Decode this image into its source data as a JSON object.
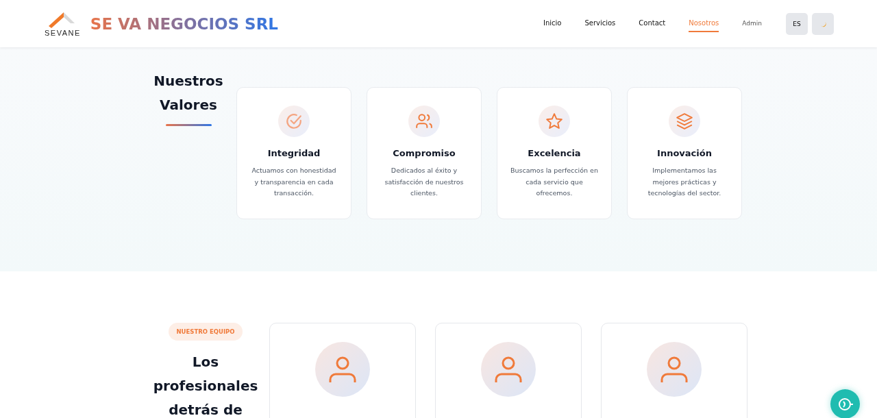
{
  "header": {
    "logo_text": "SEVANE",
    "brand": "SE VA NEGOCIOS SRL",
    "nav": [
      {
        "label": "Inicio",
        "kind": "link",
        "selected": false
      },
      {
        "label": "Servicios",
        "kind": "link",
        "selected": false
      },
      {
        "label": "Contact",
        "kind": "link",
        "selected": false
      },
      {
        "label": "Nosotros",
        "kind": "link",
        "selected": true
      },
      {
        "label": "Admin",
        "kind": "muted",
        "selected": false
      }
    ],
    "language_button": "ES"
  },
  "values": {
    "title": "Nuestros Valores",
    "cards": [
      {
        "kind": "check",
        "title": "Integridad",
        "text": "Actuamos con honestidad y transparencia en cada transacción."
      },
      {
        "kind": "users",
        "title": "Compromiso",
        "text": "Dedicados al éxito y satisfacción de nuestros clientes."
      },
      {
        "kind": "star",
        "title": "Excelencia",
        "text": "Buscamos la perfección en cada servicio que ofrecemos."
      },
      {
        "kind": "layers",
        "title": "Innovación",
        "text": "Implementamos las mejores prácticas y tecnologías del sector."
      }
    ]
  },
  "team": {
    "badge": "NUESTRO EQUIPO",
    "title": "Los profesionales detrás de",
    "members": [
      {
        "kind": "person"
      },
      {
        "kind": "person"
      },
      {
        "kind": "person"
      }
    ]
  }
}
